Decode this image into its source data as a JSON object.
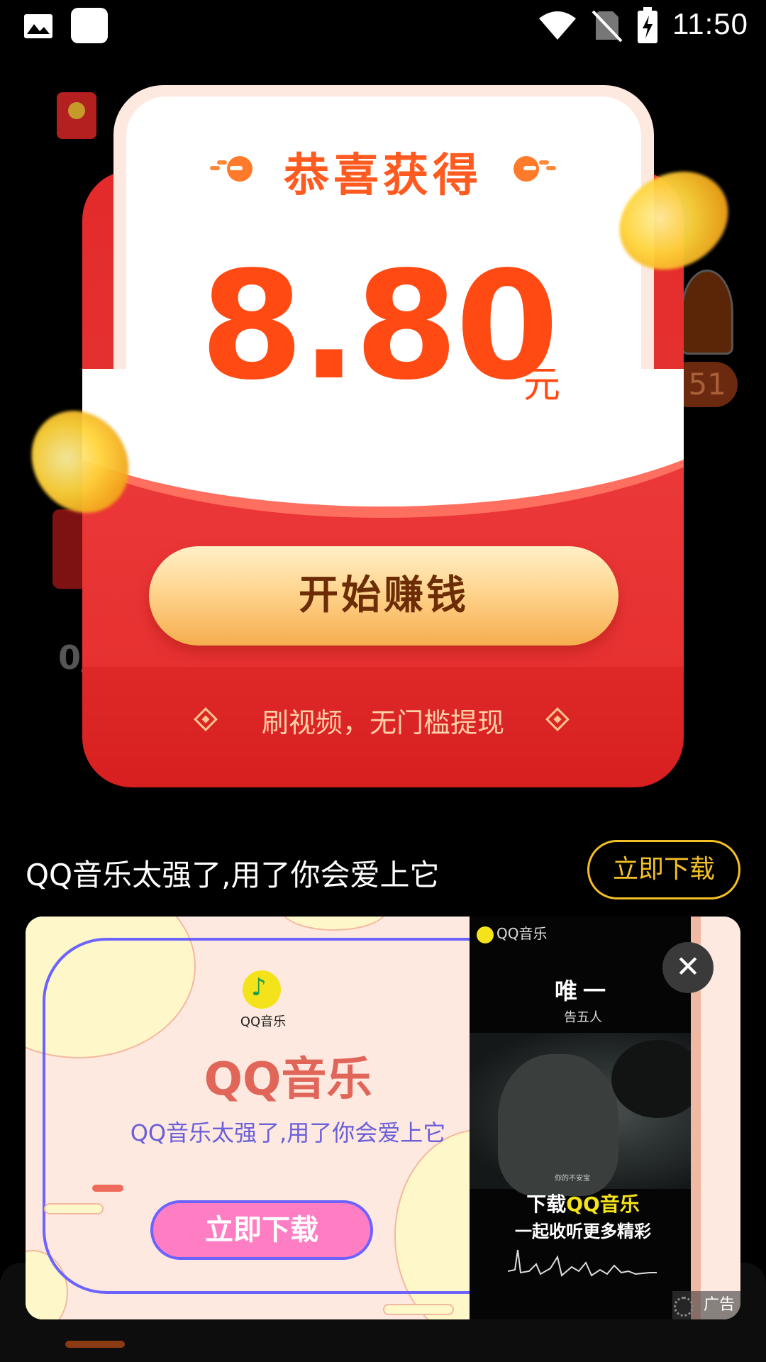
{
  "status_bar": {
    "time": "11:50",
    "icons": [
      "image-icon",
      "app-square-icon",
      "wifi-icon",
      "no-sim-icon",
      "battery-charging-icon"
    ]
  },
  "background": {
    "progress_fragment": "0/",
    "badge_fragment": "51"
  },
  "reward_popup": {
    "title": "恭喜获得",
    "amount": "8.80",
    "unit": "元",
    "button_label": "开始赚钱",
    "slogan": "刷视频，无门槛提现",
    "colors": {
      "packet_red": "#e63535",
      "amount_orange": "#ff4a14",
      "button_gold": "#ffd58f"
    }
  },
  "ad": {
    "title": "QQ音乐太强了,用了你会爱上它",
    "download_label": "立即下载",
    "creative": {
      "logo_text": "QQ音乐",
      "brand": "QQ音乐",
      "subtitle": "QQ音乐太强了,用了你会爱上它",
      "button_label": "立即下载"
    },
    "video": {
      "logo_text": "QQ音乐",
      "song": "唯一",
      "artist": "告五人",
      "caption": "你的不安宝",
      "cta_prefix": "下载",
      "cta_highlight": "QQ音乐",
      "cta_line2": "一起收听更多精彩"
    },
    "close_symbol": "✕",
    "tag": "广告"
  }
}
